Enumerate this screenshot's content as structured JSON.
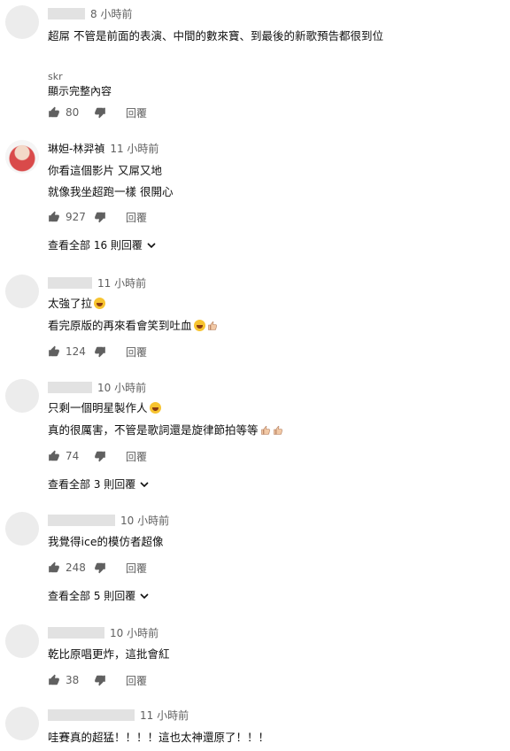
{
  "comments": [
    {
      "name": "",
      "time": "8 小時前",
      "text": "超屌 不管是前面的表演、中間的數來寶、到最後的新歌預告都很到位",
      "translator": "skr",
      "show_more": "顯示完整內容",
      "likes": "80",
      "reply_label": "回覆"
    },
    {
      "name": "琳妲-林羿禎",
      "time": "11 小時前",
      "text1": "你看這個影片 又屌又地",
      "text2": "就像我坐超跑一樣 很開心",
      "likes": "927",
      "reply_label": "回覆",
      "view_replies": "查看全部 16 則回覆"
    },
    {
      "name": "",
      "time": "11 小時前",
      "text1": "太強了拉",
      "text2": "看完原版的再來看會笑到吐血",
      "likes": "124",
      "reply_label": "回覆"
    },
    {
      "name": "",
      "time": "10 小時前",
      "text1": "只剩一個明星製作人",
      "text2": "真的很厲害，不管是歌詞還是旋律節拍等等",
      "likes": "74",
      "reply_label": "回覆",
      "view_replies": "查看全部 3 則回覆"
    },
    {
      "name": "",
      "time": "10 小時前",
      "text1": "我覺得ice的模仿者超像",
      "likes": "248",
      "reply_label": "回覆",
      "view_replies": "查看全部 5 則回覆"
    },
    {
      "name": "",
      "time": "10 小時前",
      "text1": "乾比原唱更炸，這批會紅",
      "likes": "38",
      "reply_label": "回覆"
    },
    {
      "name": "",
      "time": "11 小時前",
      "text1": "哇賽真的超猛！！！！這也太神還原了！！！"
    }
  ],
  "colors": {
    "secondary_text": "#606060",
    "avatar_placeholder": "#ececec"
  }
}
